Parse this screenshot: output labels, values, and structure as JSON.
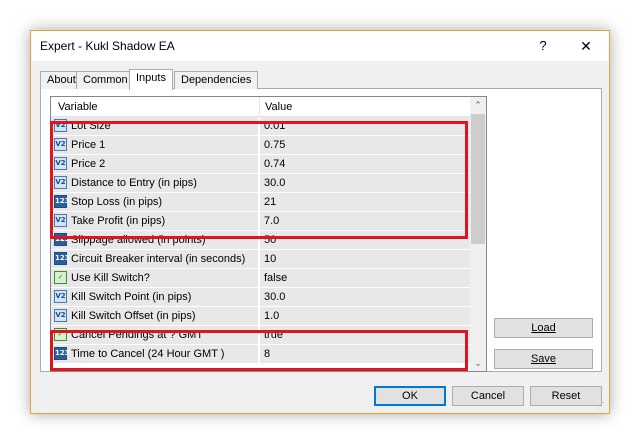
{
  "window": {
    "title": "Expert - Kukl Shadow EA",
    "help_glyph": "?",
    "close_glyph": "✕"
  },
  "tabs": [
    {
      "label": "About",
      "active": false
    },
    {
      "label": "Common",
      "active": false
    },
    {
      "label": "Inputs",
      "active": true
    },
    {
      "label": "Dependencies",
      "active": false
    }
  ],
  "grid": {
    "col_variable": "Variable",
    "col_value": "Value",
    "rows": [
      {
        "icon": "double-icon",
        "badge": "V2",
        "variable": "Lot Size",
        "value": "0.01"
      },
      {
        "icon": "double-icon",
        "badge": "V2",
        "variable": "Price 1",
        "value": "0.75"
      },
      {
        "icon": "double-icon",
        "badge": "V2",
        "variable": "Price 2",
        "value": "0.74"
      },
      {
        "icon": "double-icon",
        "badge": "V2",
        "variable": "Distance to Entry (in pips)",
        "value": "30.0"
      },
      {
        "icon": "integer-icon",
        "badge": "123",
        "variable": "Stop Loss (in pips)",
        "value": "21"
      },
      {
        "icon": "double-icon",
        "badge": "V2",
        "variable": "Take Profit (in pips)",
        "value": "7.0"
      },
      {
        "icon": "integer-icon",
        "badge": "123",
        "variable": "Slippage allowed (in points)",
        "value": "50"
      },
      {
        "icon": "integer-icon",
        "badge": "123",
        "variable": "Circuit Breaker interval (in seconds)",
        "value": "10"
      },
      {
        "icon": "boolean-icon",
        "badge": "✓",
        "variable": "Use Kill Switch?",
        "value": "false"
      },
      {
        "icon": "double-icon",
        "badge": "V2",
        "variable": "Kill Switch Point (in pips)",
        "value": "30.0"
      },
      {
        "icon": "double-icon",
        "badge": "V2",
        "variable": "Kill Switch Offset (in pips)",
        "value": "1.0"
      },
      {
        "icon": "boolean-icon",
        "badge": "✓",
        "variable": "Cancel Pendings at ? GMT",
        "value": "true"
      },
      {
        "icon": "integer-icon",
        "badge": "123",
        "variable": "Time to Cancel (24 Hour GMT )",
        "value": "8"
      }
    ]
  },
  "side_buttons": {
    "load": "Load",
    "save": "Save"
  },
  "footer_buttons": {
    "ok": "OK",
    "cancel": "Cancel",
    "reset": "Reset"
  },
  "colors": {
    "highlight": "#e0141e",
    "window_border": "#f0a030",
    "row_bg": "#e8e8e8"
  },
  "scroll": {
    "up_glyph": "⌃",
    "down_glyph": "⌄"
  }
}
